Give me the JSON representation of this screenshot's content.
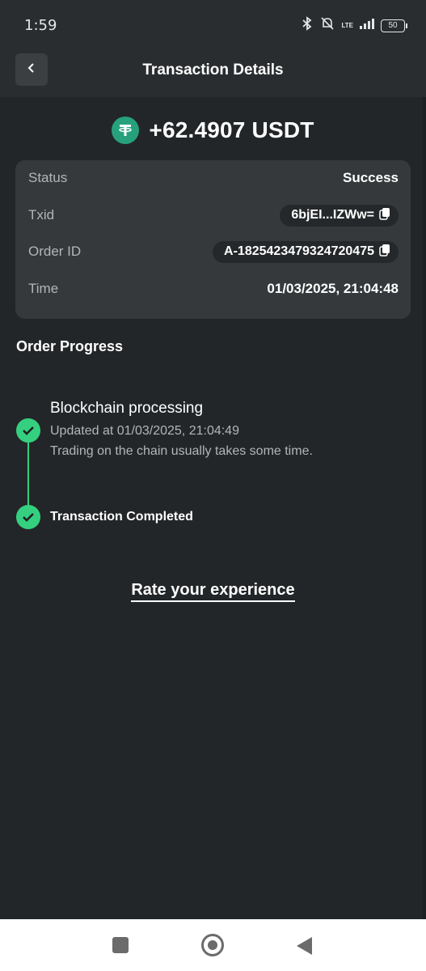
{
  "status_bar": {
    "time": "1:59",
    "network": "LTE",
    "battery": "50"
  },
  "header": {
    "title": "Transaction Details"
  },
  "amount": {
    "value": "+62.4907 USDT",
    "icon": "tether-icon",
    "icon_color": "#26a17b"
  },
  "details": [
    {
      "label": "Status",
      "value": "Success"
    },
    {
      "label": "Txid",
      "value": "6bjEI...IZWw="
    },
    {
      "label": "Order ID",
      "value": "A-1825423479324720475"
    },
    {
      "label": "Time",
      "value": "01/03/2025, 21:04:48"
    }
  ],
  "progress": {
    "title": "Order Progress",
    "steps": [
      {
        "title": "Blockchain processing",
        "updated": "Updated at 01/03/2025, 21:04:49",
        "note": "Trading on the chain usually takes some time."
      },
      {
        "title": "Transaction Completed"
      }
    ],
    "accent": "#35d07f"
  },
  "rate": {
    "label": "Rate your experience"
  }
}
